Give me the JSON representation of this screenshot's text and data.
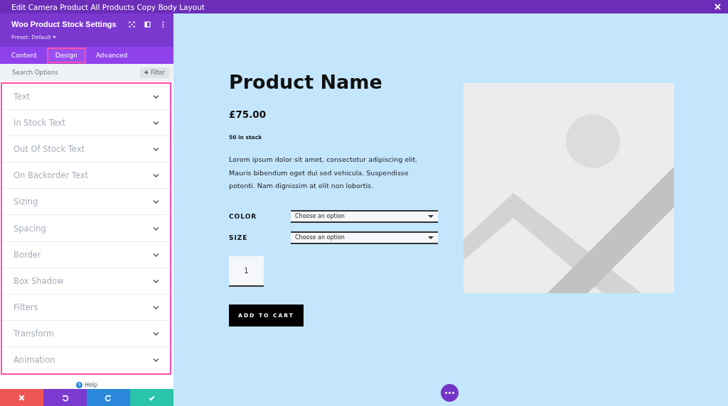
{
  "window": {
    "title": "Edit Camera Product All Products Copy Body Layout"
  },
  "panel": {
    "title": "Woo Product Stock Settings",
    "preset": "Preset: Default",
    "tabs": [
      {
        "label": "Content",
        "selected": false
      },
      {
        "label": "Design",
        "selected": true
      },
      {
        "label": "Advanced",
        "selected": false
      }
    ],
    "search": {
      "placeholder": "Search Options"
    },
    "filter_button": "Filter",
    "groups": [
      {
        "label": "Text",
        "expanded": false
      },
      {
        "label": "In Stock Text",
        "expanded": false
      },
      {
        "label": "Out Of Stock Text",
        "expanded": false
      },
      {
        "label": "On Backorder Text",
        "expanded": false
      },
      {
        "label": "Sizing",
        "expanded": false
      },
      {
        "label": "Spacing",
        "expanded": false
      },
      {
        "label": "Border",
        "expanded": false
      },
      {
        "label": "Box Shadow",
        "expanded": false
      },
      {
        "label": "Filters",
        "expanded": false
      },
      {
        "label": "Transform",
        "expanded": false
      },
      {
        "label": "Animation",
        "expanded": false
      }
    ],
    "help": "Help",
    "actions": [
      {
        "kind": "discard",
        "color": "#ef5555"
      },
      {
        "kind": "undo",
        "color": "#7b3ad0"
      },
      {
        "kind": "redo",
        "color": "#2b87da"
      },
      {
        "kind": "save",
        "color": "#29c4a9"
      }
    ]
  },
  "product": {
    "name": "Product Name",
    "price": "£75.00",
    "stock": "50 in stock",
    "description": "Lorem ipsum dolor sit amet, consectetur adipiscing elit. Mauris bibendum eget dui sed vehicula. Suspendisse potenti. Nam dignissim at elit non lobortis.",
    "attributes": [
      {
        "label": "COLOR",
        "placeholder": "Choose an option"
      },
      {
        "label": "SIZE",
        "placeholder": "Choose an option"
      }
    ],
    "quantity": "1",
    "add_to_cart": "ADD TO CART",
    "image": {
      "kind": "placeholder"
    }
  }
}
